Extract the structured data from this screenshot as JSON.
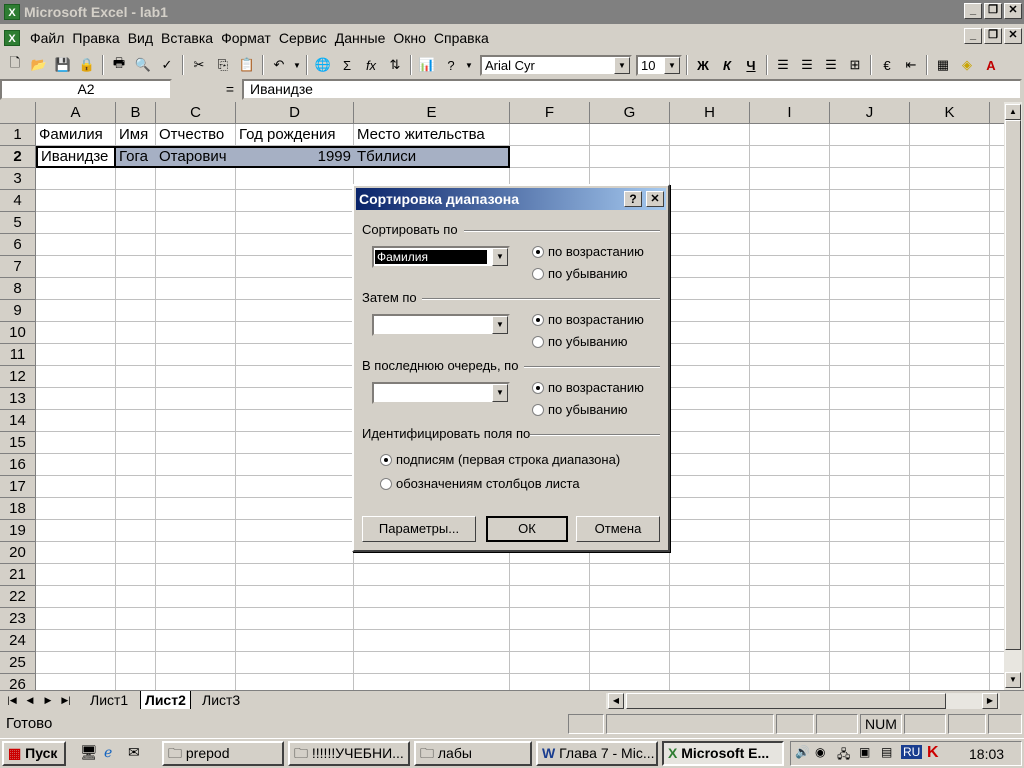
{
  "window": {
    "title": "Microsoft Excel - lab1"
  },
  "menu": [
    "Файл",
    "Правка",
    "Вид",
    "Вставка",
    "Формат",
    "Сервис",
    "Данные",
    "Окно",
    "Справка"
  ],
  "toolbar": {
    "font_name": "Arial Cyr",
    "font_size": "10",
    "bold": "Ж",
    "italic": "К",
    "underline": "Ч"
  },
  "formula_bar": {
    "name_box": "A2",
    "equals": "=",
    "content": "Иванидзе"
  },
  "columns": [
    "A",
    "B",
    "C",
    "D",
    "E",
    "F",
    "G",
    "H",
    "I",
    "J",
    "K"
  ],
  "rows": [
    "1",
    "2",
    "3",
    "4",
    "5",
    "6",
    "7",
    "8",
    "9",
    "10",
    "11",
    "12",
    "13",
    "14",
    "15",
    "16",
    "17",
    "18",
    "19",
    "20",
    "21",
    "22",
    "23",
    "24",
    "25",
    "26"
  ],
  "cells": {
    "r1": [
      "Фамилия",
      "Имя",
      "Отчество",
      "Год рождения",
      "Место жительства"
    ],
    "r2": [
      "Иванидзе",
      "Гога",
      "Отарович",
      "1999",
      "Тбилиси"
    ]
  },
  "sheets": [
    "Лист1",
    "Лист2",
    "Лист3"
  ],
  "active_sheet": "Лист2",
  "status": {
    "ready": "Готово",
    "num": "NUM"
  },
  "dialog": {
    "title": "Сортировка диапазона",
    "sort_by_label": "Сортировать по",
    "sort_by_value": "Фамилия",
    "then_by_label": "Затем по",
    "last_by_label": "В последнюю очередь, по",
    "ascending": "по возрастанию",
    "descending": "по убыванию",
    "identify_label": "Идентифицировать поля по",
    "by_labels": "подписям (первая строка диапазона)",
    "by_columns": "обозначениям столбцов листа",
    "options_button": "Параметры...",
    "ok_button": "ОК",
    "cancel_button": "Отмена",
    "help": "?",
    "close": "✕"
  },
  "taskbar": {
    "start": "Пуск",
    "buttons": [
      "prepod",
      "!!!!!!УЧЕБНИ...",
      "лабы",
      "Глава 7 - Mic...",
      "Microsoft E..."
    ],
    "tray_lang": "RU",
    "clock": "18:03"
  }
}
